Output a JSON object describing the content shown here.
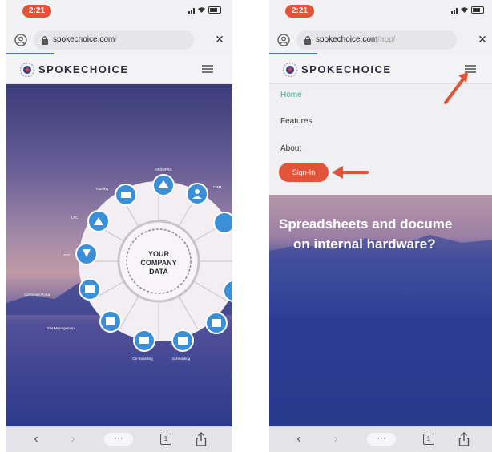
{
  "left_screen": {
    "status": {
      "time": "2:21"
    },
    "browser": {
      "url_host": "spokechoice.com",
      "url_path": "/"
    },
    "site": {
      "logo_text": "SPOKECHOICE"
    },
    "wheel": {
      "center_lines": [
        "YOUR",
        "COMPANY",
        "DATA"
      ],
      "labels": [
        "HR/INFRA",
        "CRM",
        "Training",
        "LTC",
        "DOC",
        "Customer Portal",
        "Site Management",
        "On-Boarding",
        "Scheduling"
      ]
    },
    "bottom_nav": {
      "back": "‹",
      "forward": "›",
      "more": "···",
      "tabs": "1"
    }
  },
  "right_screen": {
    "status": {
      "time": "2:21"
    },
    "browser": {
      "url_host": "spokechoice.com",
      "url_path": "/app/"
    },
    "site": {
      "logo_text": "SPOKECHOICE"
    },
    "menu": {
      "items": [
        "Home",
        "Features",
        "About"
      ],
      "signin": "Sign-In"
    },
    "hero": {
      "headline_line1": "Spreadsheets and docume",
      "headline_line2": "on internal hardware?"
    },
    "bottom_nav": {
      "back": "‹",
      "forward": "›",
      "more": "···",
      "tabs": "1"
    }
  },
  "colors": {
    "accent_red": "#e2543a",
    "menu_active": "#3bb08f",
    "wheel_icon_blue": "#3b8fd9"
  }
}
